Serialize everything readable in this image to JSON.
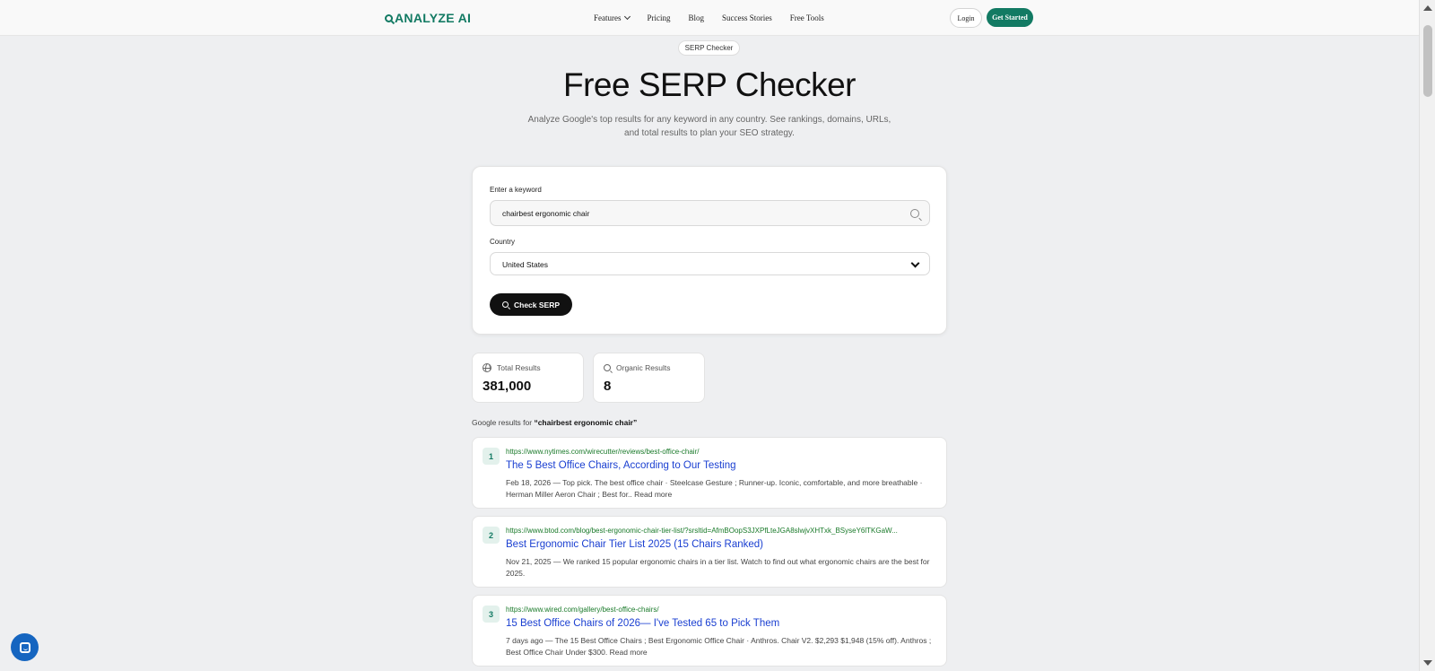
{
  "nav": {
    "logo": "ANALYZE AI",
    "links": [
      "Features",
      "Pricing",
      "Blog",
      "Success Stories",
      "Free Tools"
    ],
    "login": "Login",
    "get_started": "Get Started"
  },
  "hero": {
    "pill": "SERP Checker",
    "title": "Free SERP Checker",
    "subtitle": "Analyze Google's top results for any keyword in any country. See rankings, domains, URLs, and total results to plan your SEO strategy."
  },
  "form": {
    "keyword_label": "Enter a keyword",
    "keyword_value": "chairbest ergonomic chair",
    "country_label": "Country",
    "country_value": "United States",
    "submit": "Check SERP"
  },
  "stats": {
    "total_label": "Total Results",
    "total_value": "381,000",
    "organic_label": "Organic Results",
    "organic_value": "8"
  },
  "results_header": {
    "prefix": "Google results for ",
    "query": "“chairbest ergonomic chair”"
  },
  "results": [
    {
      "rank": "1",
      "url": "https://www.nytimes.com/wirecutter/reviews/best-office-chair/",
      "title": "The 5 Best Office Chairs, According to Our Testing",
      "snippet": "Feb 18, 2026 — Top pick. The best office chair · Steelcase Gesture ; Runner-up. Iconic, comfortable, and more breathable · Herman Miller Aeron Chair ; Best for.. Read more"
    },
    {
      "rank": "2",
      "url": "https://www.btod.com/blog/best-ergonomic-chair-tier-list/?srsltid=AfmBOopS3JXPfLteJGA8slwjvXHTxk_BSyseY6lTKGaW...",
      "title": "Best Ergonomic Chair Tier List 2025 (15 Chairs Ranked)",
      "snippet": "Nov 21, 2025 — We ranked 15 popular ergonomic chairs in a tier list. Watch to find out what ergonomic chairs are the best for 2025."
    },
    {
      "rank": "3",
      "url": "https://www.wired.com/gallery/best-office-chairs/",
      "title": "15 Best Office Chairs of 2026— I've Tested 65 to Pick Them",
      "snippet": "7 days ago — The 15 Best Office Chairs ; Best Ergonomic Office Chair · Anthros. Chair V2. $2,293 $1,948 (15% off). Anthros ; Best Office Chair Under $300. Read more"
    }
  ],
  "colors": {
    "brand": "#127a63",
    "link": "#1a3fd1",
    "url": "#1a7a2a",
    "chat": "#1565c0"
  },
  "icons": [
    "search-icon",
    "chevron-down-icon",
    "globe-icon",
    "chat-icon"
  ]
}
